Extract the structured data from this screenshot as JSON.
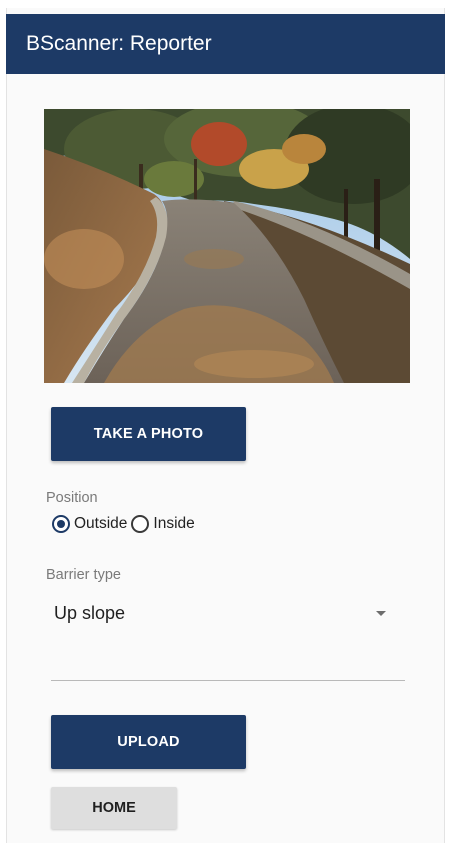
{
  "app": {
    "title": "BScanner: Reporter",
    "primary_color": "#1d3a66"
  },
  "photo": {
    "subject": "autumn park path sloping uphill"
  },
  "buttons": {
    "take_photo": "TAKE A PHOTO",
    "upload": "UPLOAD",
    "home": "HOME"
  },
  "position": {
    "label": "Position",
    "options": [
      {
        "label": "Outside",
        "selected": true
      },
      {
        "label": "Inside",
        "selected": false
      }
    ]
  },
  "barrier": {
    "label": "Barrier type",
    "selected": "Up slope"
  },
  "icons": {
    "dropdown": "arrow-drop-down-icon"
  }
}
